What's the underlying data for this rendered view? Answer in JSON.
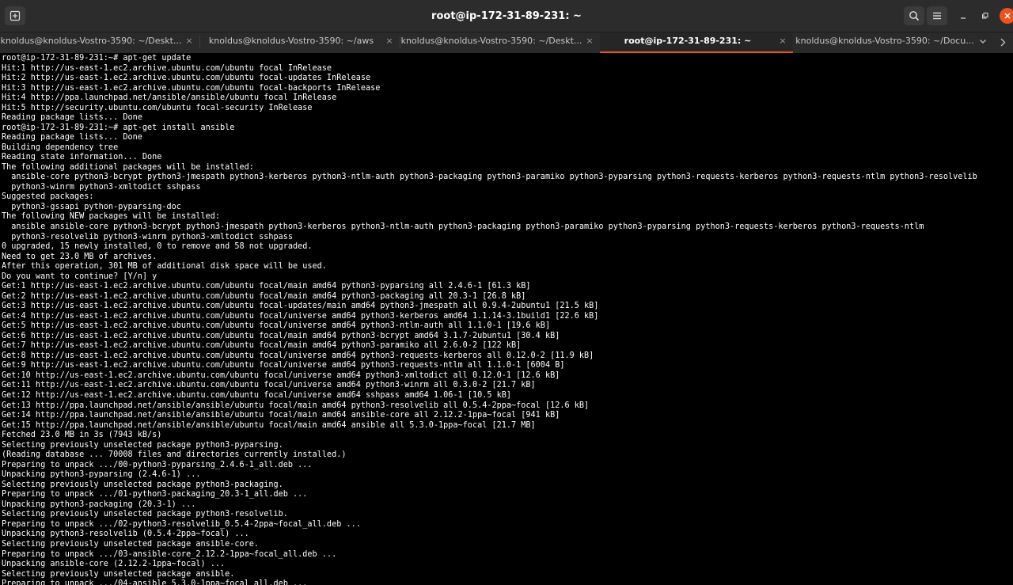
{
  "window": {
    "title": "root@ip-172-31-89-231: ~",
    "icons": {
      "new_tab": "new-tab-icon",
      "search": "search-icon",
      "menu": "hamburger-menu-icon",
      "minimize": "minimize-icon",
      "maximize": "maximize-icon",
      "close": "close-icon"
    }
  },
  "tabs": [
    {
      "label": "knoldus@knoldus-Vostro-3590: ~/Deskt...",
      "close": "×",
      "active": false
    },
    {
      "label": "knoldus@knoldus-Vostro-3590: ~/aws",
      "close": "×",
      "active": false
    },
    {
      "label": "knoldus@knoldus-Vostro-3590: ~/Deskt...",
      "close": "×",
      "active": false
    },
    {
      "label": "root@ip-172-31-89-231: ~",
      "close": "×",
      "active": true
    },
    {
      "label": "knoldus@knoldus-Vostro-3590: ~/Docu...",
      "close": "×",
      "active": false
    }
  ],
  "colors": {
    "accent": "#e95420",
    "terminal_bg": "#000000",
    "terminal_fg": "#ffffff",
    "titlebar_bg": "#2c2c2c"
  },
  "terminal": {
    "lines": [
      "root@ip-172-31-89-231:~# apt-get update",
      "Hit:1 http://us-east-1.ec2.archive.ubuntu.com/ubuntu focal InRelease",
      "Hit:2 http://us-east-1.ec2.archive.ubuntu.com/ubuntu focal-updates InRelease",
      "Hit:3 http://us-east-1.ec2.archive.ubuntu.com/ubuntu focal-backports InRelease",
      "Hit:4 http://ppa.launchpad.net/ansible/ansible/ubuntu focal InRelease",
      "Hit:5 http://security.ubuntu.com/ubuntu focal-security InRelease",
      "Reading package lists... Done",
      "root@ip-172-31-89-231:~# apt-get install ansible",
      "Reading package lists... Done",
      "Building dependency tree",
      "Reading state information... Done",
      "The following additional packages will be installed:",
      "  ansible-core python3-bcrypt python3-jmespath python3-kerberos python3-ntlm-auth python3-packaging python3-paramiko python3-pyparsing python3-requests-kerberos python3-requests-ntlm python3-resolvelib",
      "  python3-winrm python3-xmltodict sshpass",
      "Suggested packages:",
      "  python3-gssapi python-pyparsing-doc",
      "The following NEW packages will be installed:",
      "  ansible ansible-core python3-bcrypt python3-jmespath python3-kerberos python3-ntlm-auth python3-packaging python3-paramiko python3-pyparsing python3-requests-kerberos python3-requests-ntlm",
      "  python3-resolvelib python3-winrm python3-xmltodict sshpass",
      "0 upgraded, 15 newly installed, 0 to remove and 58 not upgraded.",
      "Need to get 23.0 MB of archives.",
      "After this operation, 301 MB of additional disk space will be used.",
      "Do you want to continue? [Y/n] y",
      "Get:1 http://us-east-1.ec2.archive.ubuntu.com/ubuntu focal/main amd64 python3-pyparsing all 2.4.6-1 [61.3 kB]",
      "Get:2 http://us-east-1.ec2.archive.ubuntu.com/ubuntu focal/main amd64 python3-packaging all 20.3-1 [26.8 kB]",
      "Get:3 http://us-east-1.ec2.archive.ubuntu.com/ubuntu focal-updates/main amd64 python3-jmespath all 0.9.4-2ubuntu1 [21.5 kB]",
      "Get:4 http://us-east-1.ec2.archive.ubuntu.com/ubuntu focal/universe amd64 python3-kerberos amd64 1.1.14-3.1build1 [22.6 kB]",
      "Get:5 http://us-east-1.ec2.archive.ubuntu.com/ubuntu focal/universe amd64 python3-ntlm-auth all 1.1.0-1 [19.6 kB]",
      "Get:6 http://us-east-1.ec2.archive.ubuntu.com/ubuntu focal/main amd64 python3-bcrypt amd64 3.1.7-2ubuntu1 [30.4 kB]",
      "Get:7 http://us-east-1.ec2.archive.ubuntu.com/ubuntu focal/main amd64 python3-paramiko all 2.6.0-2 [122 kB]",
      "Get:8 http://us-east-1.ec2.archive.ubuntu.com/ubuntu focal/universe amd64 python3-requests-kerberos all 0.12.0-2 [11.9 kB]",
      "Get:9 http://us-east-1.ec2.archive.ubuntu.com/ubuntu focal/universe amd64 python3-requests-ntlm all 1.1.0-1 [6004 B]",
      "Get:10 http://us-east-1.ec2.archive.ubuntu.com/ubuntu focal/universe amd64 python3-xmltodict all 0.12.0-1 [12.6 kB]",
      "Get:11 http://us-east-1.ec2.archive.ubuntu.com/ubuntu focal/universe amd64 python3-winrm all 0.3.0-2 [21.7 kB]",
      "Get:12 http://us-east-1.ec2.archive.ubuntu.com/ubuntu focal/universe amd64 sshpass amd64 1.06-1 [10.5 kB]",
      "Get:13 http://ppa.launchpad.net/ansible/ansible/ubuntu focal/main amd64 python3-resolvelib all 0.5.4-2ppa~focal [12.6 kB]",
      "Get:14 http://ppa.launchpad.net/ansible/ansible/ubuntu focal/main amd64 ansible-core all 2.12.2-1ppa~focal [941 kB]",
      "Get:15 http://ppa.launchpad.net/ansible/ansible/ubuntu focal/main amd64 ansible all 5.3.0-1ppa~focal [21.7 MB]",
      "Fetched 23.0 MB in 3s (7943 kB/s)",
      "Selecting previously unselected package python3-pyparsing.",
      "(Reading database ... 70008 files and directories currently installed.)",
      "Preparing to unpack .../00-python3-pyparsing_2.4.6-1_all.deb ...",
      "Unpacking python3-pyparsing (2.4.6-1) ...",
      "Selecting previously unselected package python3-packaging.",
      "Preparing to unpack .../01-python3-packaging_20.3-1_all.deb ...",
      "Unpacking python3-packaging (20.3-1) ...",
      "Selecting previously unselected package python3-resolvelib.",
      "Preparing to unpack .../02-python3-resolvelib_0.5.4-2ppa~focal_all.deb ...",
      "Unpacking python3-resolvelib (0.5.4-2ppa~focal) ...",
      "Selecting previously unselected package ansible-core.",
      "Preparing to unpack .../03-ansible-core_2.12.2-1ppa~focal_all.deb ...",
      "Unpacking ansible-core (2.12.2-1ppa~focal) ...",
      "Selecting previously unselected package ansible.",
      "Preparing to unpack .../04-ansible_5.3.0-1ppa~focal_all.deb ..."
    ]
  }
}
